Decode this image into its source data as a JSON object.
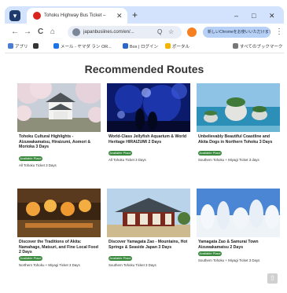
{
  "browser": {
    "tab_title": "Tohoku Highway Bus Ticket –",
    "tab_close": "✕",
    "new_tab": "+",
    "minimize": "–",
    "maximize": "□",
    "close": "✕",
    "back": "←",
    "forward": "→",
    "reload": "C",
    "home": "⌂",
    "url": "japanbusiines.com/en/...",
    "zoom": "Q",
    "star": "☆",
    "pill": "新しいChromeをお使いいただけます",
    "menu": "⋮"
  },
  "bookmarks": [
    {
      "label": "アプリ",
      "color": "#4a7bd5"
    },
    {
      "label": "",
      "color": "#333333"
    },
    {
      "label": "メール - ヤマダ ラン OR...",
      "color": "#1a73e8"
    },
    {
      "label": "Box | ログイン",
      "color": "#2b66c8"
    },
    {
      "label": "ポータル",
      "color": "#f4b400"
    },
    {
      "label": "すべてのブックマーク",
      "color": "#777777"
    }
  ],
  "page": {
    "heading": "Recommended Routes",
    "scroll_top": "⇧"
  },
  "cards": [
    {
      "title": "Tohoku Cultural Highlights - Aizuwakamatsu, Hiraizumi, Aomori & Morioka 3 Days",
      "badge": "Available Place",
      "location": "All Tohoku Ticket 3 Days",
      "image": "sakura-castle"
    },
    {
      "title": "World-Class Jellyfish Aquarium & World Heritage HIRAIZUMI 2 Days",
      "badge": "Available Place",
      "location": "All Tohoku Ticket 3 Days",
      "image": "jellyfish"
    },
    {
      "title": "Unbelievably Beautiful Coastline and Akita Dogs in Northern Tohoku 3 Days",
      "badge": "Available Place",
      "location": "Southern Tohoku + Miyagi Ticket 3 days",
      "image": "coastline"
    },
    {
      "title": "Discover the Traditions of Akita: Namahage, Matsuri, and Fine Local Food 2 Days",
      "badge": "Available Place",
      "location": "Northern Tohoku + Miyagi Ticket 3 Days",
      "image": "lanterns"
    },
    {
      "title": "Discover Yamagata Zao - Mountains, Hot Springs & Seaside Japan 3 Days",
      "badge": "Available Place",
      "location": "Southern Tohoku Ticket 3 Days",
      "image": "temple"
    },
    {
      "title": "Yamagata Zao & Samurai Town Aizuwakamatsu 2 Days",
      "badge": "Available Place",
      "location": "Southern Tohoku + Miyagi Ticket 3 Days",
      "image": "snow-monsters"
    }
  ]
}
